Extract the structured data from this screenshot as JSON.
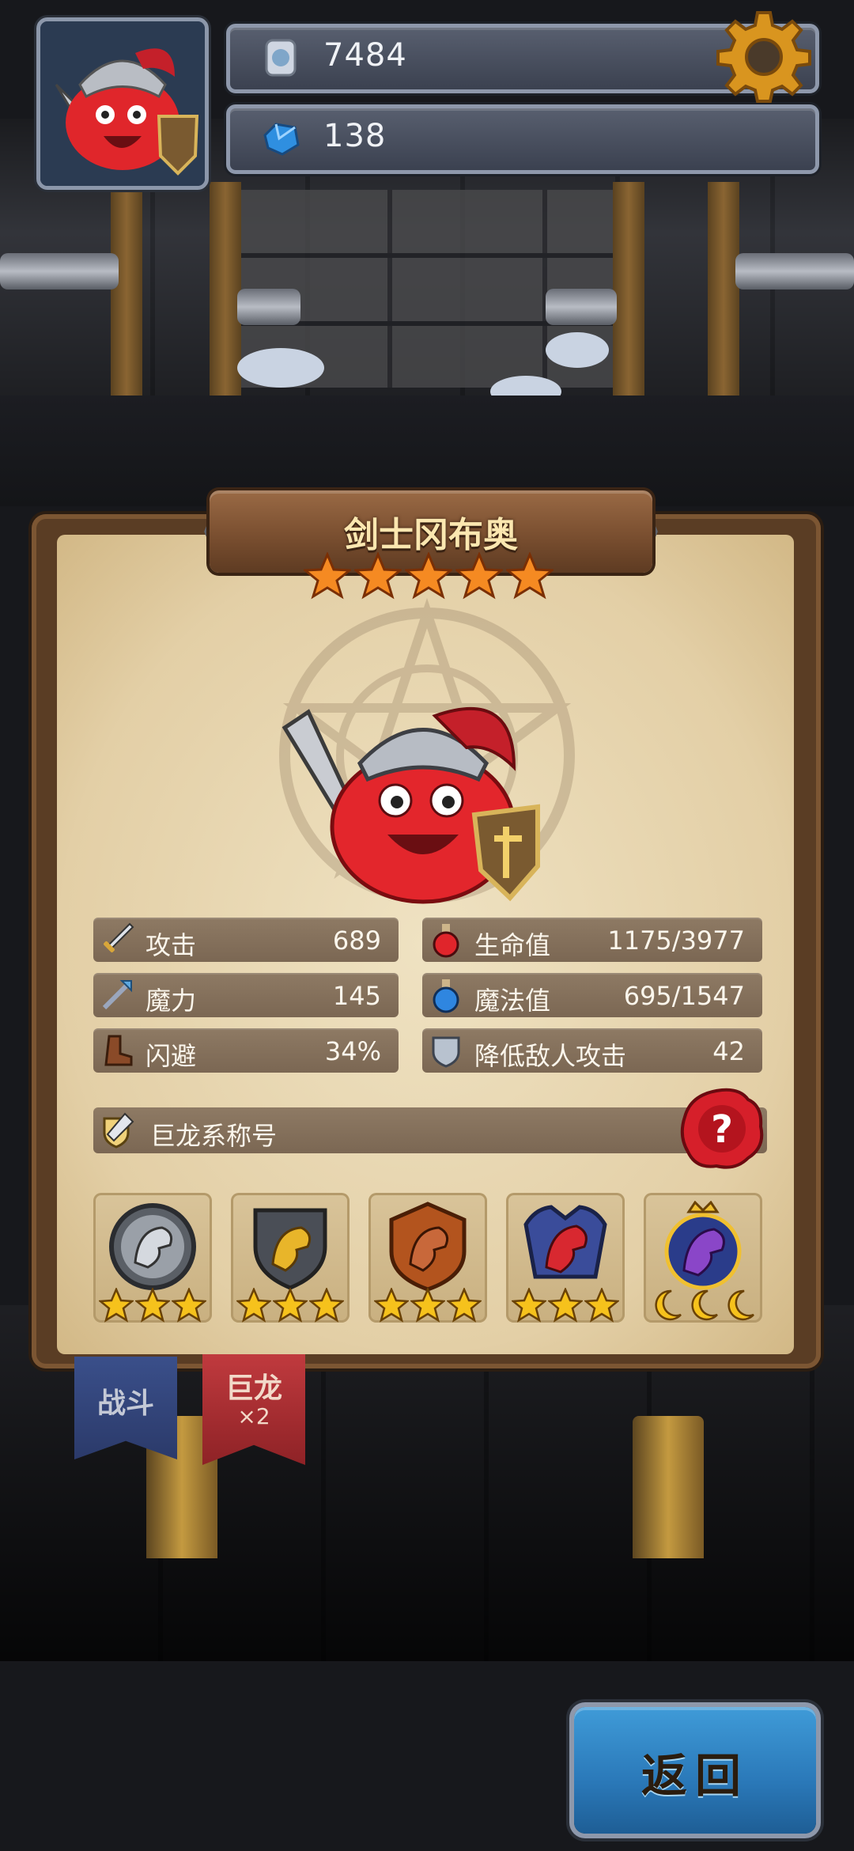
{
  "resources": {
    "coins": {
      "icon": "silver-coin-icon",
      "value": "7484"
    },
    "gems": {
      "icon": "blue-gem-icon",
      "value": "138"
    }
  },
  "hero": {
    "name": "剑士冈布奥",
    "stars": 5
  },
  "stats": [
    {
      "icon": "sword-icon",
      "label": "攻击",
      "value": "689"
    },
    {
      "icon": "magic-staff-icon",
      "label": "魔力",
      "value": "145"
    },
    {
      "icon": "boot-icon",
      "label": "闪避",
      "value": "34%"
    },
    {
      "icon": "red-potion-icon",
      "label": "生命值",
      "value": "1175/3977"
    },
    {
      "icon": "blue-potion-icon",
      "label": "魔法值",
      "value": "695/1547"
    },
    {
      "icon": "shield-icon",
      "label": "降低敌人攻击",
      "value": "42"
    }
  ],
  "title_series": {
    "icon": "sword-shield-icon",
    "label": "巨龙系称号"
  },
  "dragon_badges": [
    {
      "name": "silver-dragon-badge-icon",
      "stars": 3,
      "star_type": "star"
    },
    {
      "name": "gold-dragon-badge-icon",
      "stars": 3,
      "star_type": "star"
    },
    {
      "name": "bronze-dragon-badge-icon",
      "stars": 3,
      "star_type": "star"
    },
    {
      "name": "red-dragon-badge-icon",
      "stars": 3,
      "star_type": "star"
    },
    {
      "name": "purple-dragon-badge-icon",
      "stars": 3,
      "star_type": "moon"
    }
  ],
  "tabs": [
    {
      "label": "战斗",
      "count": ""
    },
    {
      "label": "巨龙",
      "count": "×2"
    }
  ],
  "back_button": {
    "label": "返回"
  },
  "colors": {
    "paper": "#e8d7b2",
    "stat_bg": "#84705b",
    "star": "#f58a22",
    "back_button": "#2e82c4"
  }
}
